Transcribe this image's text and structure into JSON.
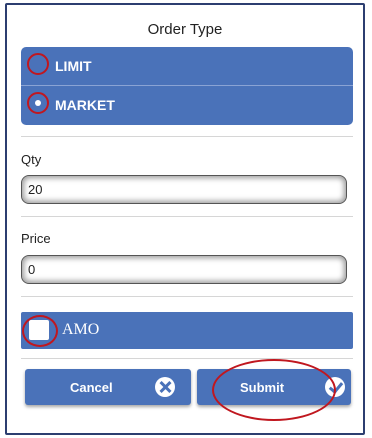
{
  "dialog": {
    "title": "Order Type"
  },
  "order_type": {
    "options": [
      {
        "label": "LIMIT",
        "selected": false
      },
      {
        "label": "MARKET",
        "selected": true
      }
    ]
  },
  "qty": {
    "label": "Qty",
    "value": "20"
  },
  "price": {
    "label": "Price",
    "value": "0"
  },
  "amo": {
    "label": "AMO",
    "checked": false
  },
  "buttons": {
    "cancel_label": "Cancel",
    "submit_label": "Submit"
  },
  "icons": {
    "cancel": "close-icon",
    "submit": "checkmark-icon"
  },
  "colors": {
    "primary": "#4a72b9",
    "highlight": "#c0171f"
  }
}
